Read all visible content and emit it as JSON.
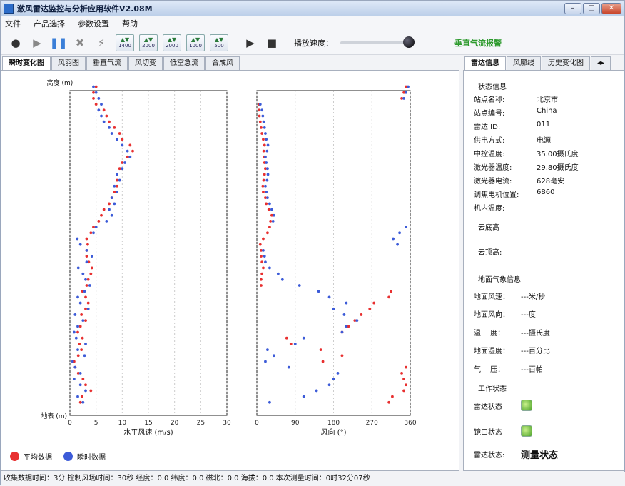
{
  "window": {
    "title": "激风雷达监控与分析应用软件V2.08M"
  },
  "menu": [
    "文件",
    "产品选择",
    "参数设置",
    "帮助"
  ],
  "toolbar": {
    "range_buttons": [
      "1400",
      "2000",
      "2000",
      "1000",
      "500"
    ],
    "speed_label": "播放速度：",
    "alarm_label": "垂直气流报警"
  },
  "left_tabs": [
    "瞬时变化图",
    "风羽图",
    "垂直气流",
    "风切变",
    "低空急流",
    "合成风"
  ],
  "right_tabs": [
    "雷达信息",
    "风廓线",
    "历史变化图"
  ],
  "chart_data": [
    {
      "type": "scatter",
      "title": "",
      "ylabel_top": "高度 (m)",
      "xlabel": "水平风速 (m/s)",
      "xlim": [
        0,
        30
      ],
      "xticks": [
        "0",
        "5",
        "10",
        "15",
        "20",
        "25",
        "30"
      ],
      "ylim": [
        0,
        1000
      ],
      "bottom_label": "地表 (m)",
      "series": [
        {
          "name": "平均数据",
          "color": "#e83030",
          "x": [
            2.0,
            2.3,
            4.0,
            3.0,
            2.5,
            1.6,
            1.0,
            0.8,
            1.6,
            2.2,
            1.8,
            2.4,
            1.5,
            2.0,
            3.0,
            2.2,
            3.0,
            3.5,
            3.0,
            2.4,
            3.2,
            3.5,
            4.0,
            4.2,
            3.6,
            3.2,
            3.2,
            3.4,
            3.2,
            4.0,
            4.5,
            5.5,
            6.0,
            6.5,
            7.5,
            8.0,
            8.5,
            9.0,
            9.0,
            9.0,
            9.5,
            10.0,
            11.0,
            12.0,
            11.5,
            10.0,
            9.5,
            8.5,
            7.5,
            7.0,
            6.5,
            5.0,
            4.5,
            4.5,
            5.0
          ],
          "y": [
            40,
            58,
            76,
            94,
            112,
            130,
            148,
            166,
            184,
            202,
            220,
            238,
            256,
            274,
            292,
            310,
            328,
            346,
            364,
            382,
            400,
            418,
            436,
            454,
            472,
            490,
            508,
            526,
            544,
            562,
            580,
            598,
            616,
            634,
            652,
            670,
            688,
            706,
            724,
            742,
            760,
            778,
            796,
            814,
            832,
            850,
            868,
            886,
            904,
            922,
            940,
            958,
            976,
            994,
            1012
          ]
        },
        {
          "name": "瞬时数据",
          "color": "#3c5bd8",
          "x": [
            2.5,
            1.5,
            3.0,
            2.0,
            0.8,
            2.0,
            1.0,
            0.5,
            2.8,
            1.5,
            3.0,
            1.2,
            0.8,
            1.5,
            2.5,
            1.0,
            3.5,
            2.0,
            1.5,
            2.8,
            3.8,
            3.0,
            2.5,
            1.6,
            3.2,
            4.2,
            3.2,
            2.0,
            1.4,
            4.5,
            5.0,
            7.0,
            8.0,
            7.5,
            8.5,
            8.0,
            9.0,
            8.5,
            9.5,
            9.0,
            10.0,
            10.5,
            11.5,
            11.0,
            10.0,
            9.0,
            8.0,
            7.5,
            6.5,
            6.0,
            5.5,
            6.0,
            5.5,
            5.0,
            4.5
          ],
          "y": [
            40,
            58,
            76,
            94,
            112,
            130,
            148,
            166,
            184,
            202,
            220,
            238,
            256,
            274,
            292,
            310,
            328,
            346,
            364,
            382,
            400,
            418,
            436,
            454,
            472,
            490,
            508,
            526,
            544,
            562,
            580,
            598,
            616,
            634,
            652,
            670,
            688,
            706,
            724,
            742,
            760,
            778,
            796,
            814,
            832,
            850,
            868,
            886,
            904,
            922,
            940,
            958,
            976,
            994,
            1012
          ]
        }
      ]
    },
    {
      "type": "scatter",
      "title": "",
      "xlabel": "风向 (°)",
      "xlim": [
        0,
        360
      ],
      "xticks": [
        "0",
        "90",
        "180",
        "270",
        "360"
      ],
      "ylim": [
        0,
        1000
      ],
      "series": [
        {
          "name": "平均数据",
          "color": "#e83030",
          "x": [
            310,
            318,
            345,
            350,
            345,
            340,
            350,
            155,
            200,
            150,
            80,
            70,
            200,
            215,
            230,
            245,
            265,
            275,
            310,
            315,
            10,
            10,
            12,
            15,
            12,
            10,
            10,
            8,
            15,
            25,
            30,
            32,
            35,
            28,
            22,
            20,
            15,
            14,
            16,
            18,
            20,
            18,
            17,
            16,
            18,
            15,
            12,
            10,
            8,
            6,
            5,
            5,
            340,
            345,
            350
          ],
          "y": [
            40,
            58,
            76,
            94,
            112,
            130,
            148,
            166,
            184,
            202,
            220,
            238,
            256,
            274,
            292,
            310,
            328,
            346,
            364,
            382,
            400,
            418,
            436,
            454,
            472,
            490,
            508,
            526,
            544,
            562,
            580,
            598,
            616,
            634,
            652,
            670,
            688,
            706,
            724,
            742,
            760,
            778,
            796,
            814,
            832,
            850,
            868,
            886,
            904,
            922,
            940,
            958,
            976,
            994,
            1012
          ]
        },
        {
          "name": "瞬时数据",
          "color": "#3c5bd8",
          "x": [
            30,
            110,
            140,
            170,
            180,
            190,
            75,
            20,
            40,
            25,
            90,
            110,
            200,
            210,
            235,
            205,
            180,
            210,
            170,
            145,
            100,
            60,
            50,
            30,
            20,
            18,
            15,
            330,
            320,
            335,
            350,
            38,
            40,
            35,
            30,
            25,
            22,
            20,
            24,
            26,
            25,
            22,
            20,
            24,
            26,
            22,
            20,
            18,
            16,
            14,
            12,
            8,
            345,
            350,
            355
          ],
          "y": [
            40,
            58,
            76,
            94,
            112,
            130,
            148,
            166,
            184,
            202,
            220,
            238,
            256,
            274,
            292,
            310,
            328,
            346,
            364,
            382,
            400,
            418,
            436,
            454,
            472,
            490,
            508,
            526,
            544,
            562,
            580,
            598,
            616,
            634,
            652,
            670,
            688,
            706,
            724,
            742,
            760,
            778,
            796,
            814,
            832,
            850,
            868,
            886,
            904,
            922,
            940,
            958,
            976,
            994,
            1012
          ]
        }
      ]
    }
  ],
  "legend": {
    "avg_label": "平均数据",
    "inst_label": "瞬时数据",
    "avg_color": "#e83030",
    "inst_color": "#3c5bd8"
  },
  "info_panel": {
    "section_status": "状态信息",
    "station_name_label": "站点名称:",
    "station_name": "北京市",
    "station_id_label": "站点编号:",
    "station_id": "China",
    "radar_id_label": "雷达 ID:",
    "radar_id": "011",
    "power_label": "供电方式:",
    "power": "电源",
    "ctrl_temp_label": "中控温度:",
    "ctrl_temp": "35.00摄氏度",
    "laser_temp_label": "激光器温度:",
    "laser_temp": "29.80摄氏度",
    "laser_current_label": "激光器电流:",
    "laser_current": "628毫安",
    "motor_pos_label": "调焦电机位置:",
    "motor_pos": "6860",
    "internal_temp_label": "机内温度:",
    "cloud_base_label": "云底高",
    "cloud_top_label": "云顶高:",
    "section_surface": "地面气象信息",
    "surface_speed_label": "地面风速：",
    "surface_speed": "---米/秒",
    "surface_dir_label": "地面风向：",
    "surface_dir": "---度",
    "temp_label": "温　 度：",
    "temp": "---摄氏度",
    "humidity_label": "地面湿度：",
    "humidity": "---百分比",
    "pressure_label": "气　 压：",
    "pressure": "---百帕",
    "section_work": "工作状态",
    "radar_state_label": "雷达状态",
    "window_state_label": "镜口状态",
    "radar_mode_label": "雷达状态:",
    "radar_mode": "测量状态"
  },
  "status_bar": "收集数据时间：3分  控制风场时间：30秒  经度：0.0  纬度：0.0  磁北：0.0  海拔：0.0  本次测量时间：0时32分07秒"
}
